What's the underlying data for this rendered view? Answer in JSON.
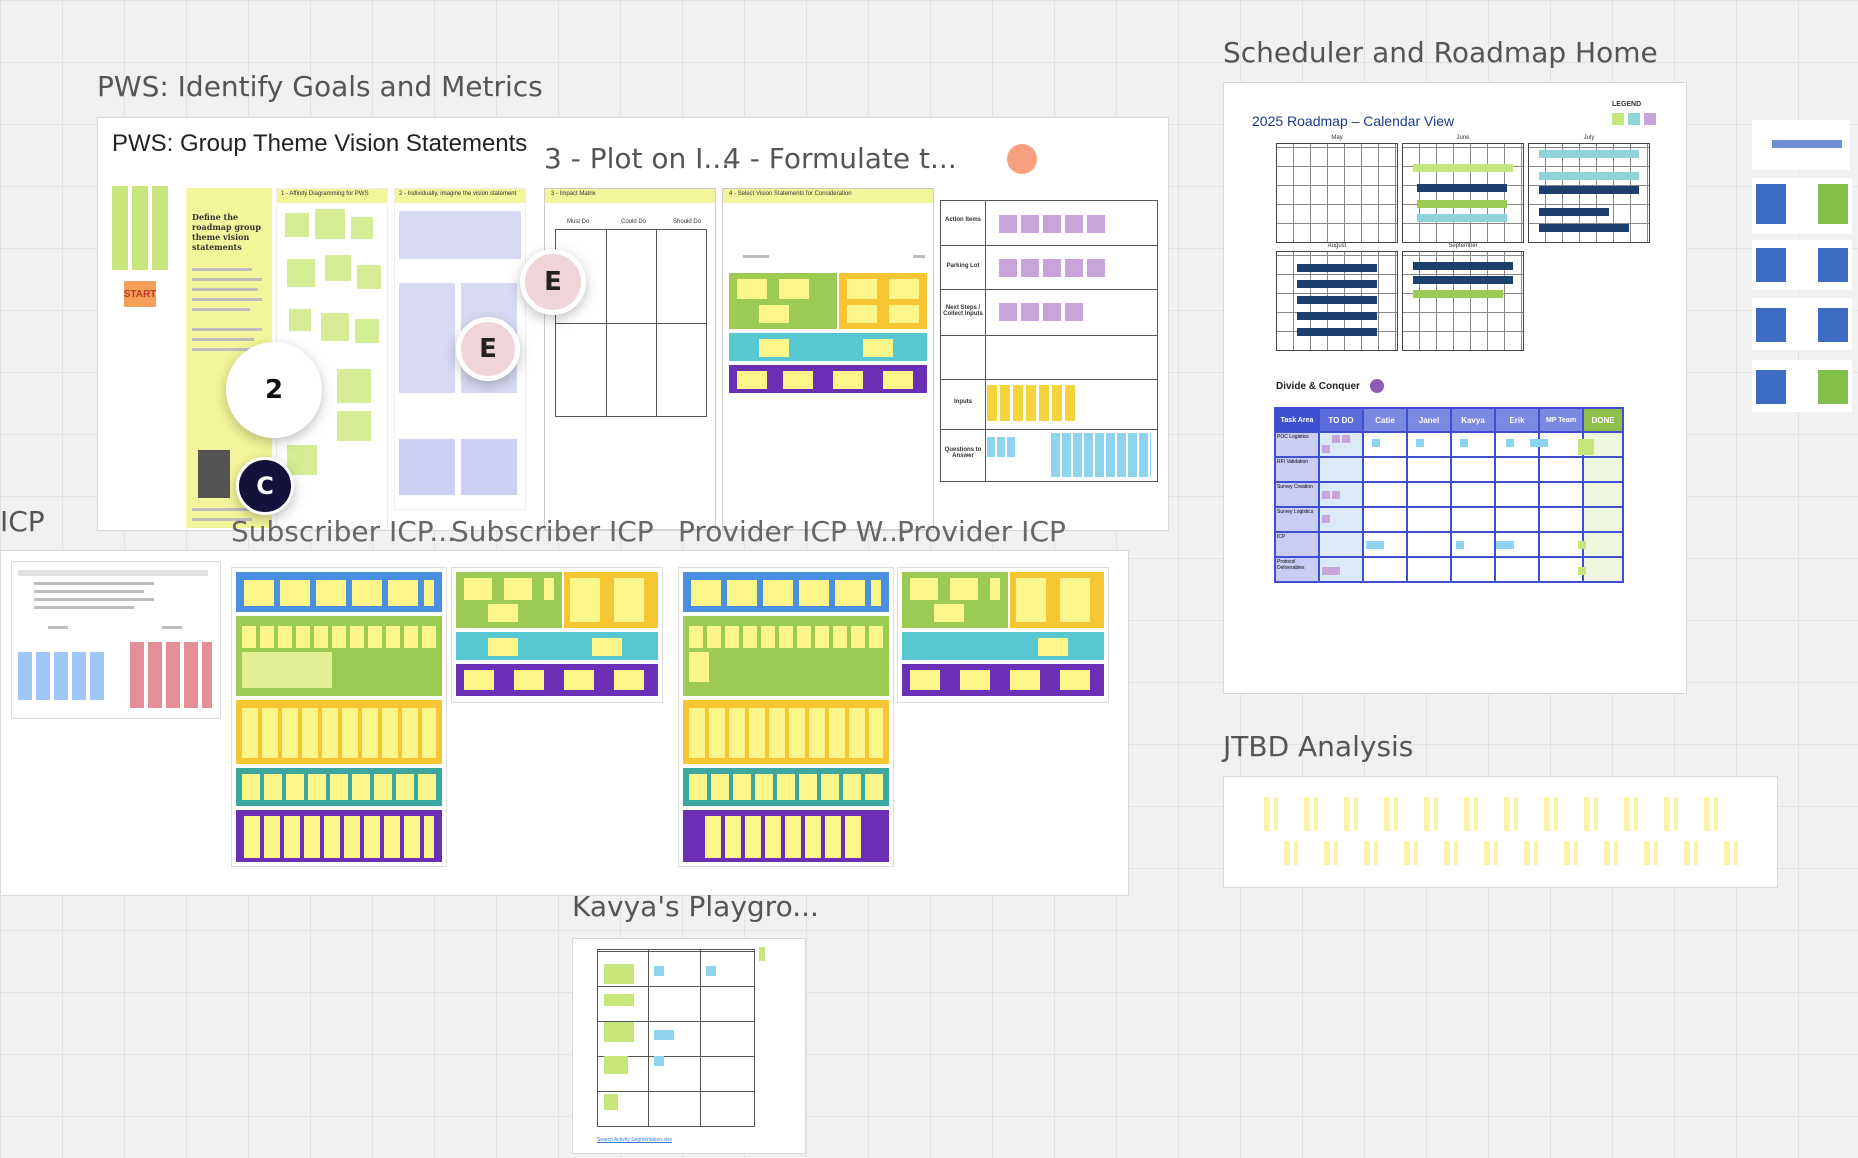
{
  "frames": {
    "pws_identify": {
      "title": "PWS: Identify Goals and Metrics"
    },
    "pws_group": {
      "title": "PWS: Group Theme Vision Statements"
    },
    "plot": {
      "title": "3 - Plot on I..."
    },
    "formulate": {
      "title": "4 - Formulate t..."
    },
    "icp": {
      "title": "ICP"
    },
    "subscriber_icp_w": {
      "title": "Subscriber ICP..."
    },
    "subscriber_icp": {
      "title": "Subscriber ICP"
    },
    "provider_icp_w": {
      "title": "Provider ICP W..."
    },
    "provider_icp": {
      "title": "Provider ICP"
    },
    "scheduler": {
      "title": "Scheduler and Roadmap Home"
    },
    "jtbd": {
      "title": "JTBD Analysis"
    },
    "kavya": {
      "title": "Kavya's Playgro..."
    }
  },
  "cards": {
    "intro_heading": "Define the roadmap group theme vision statements",
    "start_label": "START",
    "affinity": "1 - Affinity Diagramming for PWS",
    "imagine": "2 - Individually, imagine the vision statement",
    "impact": "3 - Impact Matrix",
    "impact_cols": [
      "Must Do",
      "Could Do",
      "Should Do"
    ],
    "select": "4 - Select Vision Statements for Consideration",
    "sidebar_rows": [
      "Action Items",
      "Parking Lot",
      "Next Steps / Collect Inputs",
      "",
      "Inputs",
      "Questions to Answer"
    ]
  },
  "avatars": {
    "count": "2",
    "e1": "E",
    "e2": "E",
    "c": "C"
  },
  "roadmap": {
    "title": "2025 Roadmap – Calendar View",
    "legend": "LEGEND",
    "months": [
      "May",
      "June",
      "July",
      "August",
      "September"
    ],
    "divide": "Divide & Conquer",
    "kanban_headers": [
      "Task Area",
      "TO DO",
      "Catie",
      "Janel",
      "Kavya",
      "Erik",
      "MP Team",
      "DONE"
    ],
    "kanban_rows": [
      "POC Logistics",
      "RFI Validation",
      "Survey Creation",
      "Survey Logistics",
      "ICP",
      "Protocol Deliverables"
    ]
  },
  "kavya": {
    "link": "Search Activity Segmentation.xlsx"
  },
  "colors": {
    "sticky_green": "#c6e57a",
    "sticky_yellow": "#f8f08a",
    "band_blue": "#4a90e2",
    "band_green": "#9ccb54",
    "band_yellow": "#f5c533",
    "band_teal": "#57c7d1",
    "band_purple": "#6a2fb5",
    "kanban_border": "#3e4fd0"
  }
}
